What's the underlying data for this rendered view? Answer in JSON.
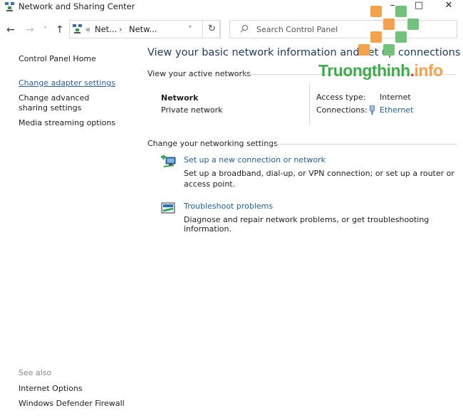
{
  "window": {
    "title": "Network and Sharing Center",
    "controls": {
      "minimize": "–",
      "maximize": "□",
      "close": "✕"
    }
  },
  "navbar": {
    "back": "←",
    "forward": "→",
    "recent": "˅",
    "up": "↑",
    "breadcrumb": {
      "overflow": "«",
      "items": [
        "Net...",
        "Netw..."
      ],
      "separator": "›"
    },
    "dropdown": "˅",
    "refresh": "↻",
    "search_placeholder": "Search Control Panel"
  },
  "sidebar": {
    "home": "Control Panel Home",
    "links": [
      "Change adapter settings",
      "Change advanced sharing settings",
      "Media streaming options"
    ],
    "see_also_label": "See also",
    "see_also": [
      "Internet Options",
      "Windows Defender Firewall"
    ]
  },
  "main": {
    "heading": "View your basic network information and set up connections",
    "active_networks_label": "View your active networks",
    "network": {
      "name": "Network",
      "type": "Private network",
      "access_type_label": "Access type:",
      "access_type": "Internet",
      "connections_label": "Connections:",
      "connection": "Ethernet"
    },
    "change_settings_label": "Change your networking settings",
    "tasks": [
      {
        "title": "Set up a new connection or network",
        "description": "Set up a broadband, dial-up, or VPN connection; or set up a router or access point."
      },
      {
        "title": "Troubleshoot problems",
        "description": "Diagnose and repair network problems, or get troubleshooting information."
      }
    ]
  },
  "watermark": {
    "brand": "Truongthinh",
    "dot": ".",
    "suffix": "info",
    "colors": {
      "green": "#3cae49",
      "orange": "#f5a24b",
      "red": "#e53935"
    }
  }
}
